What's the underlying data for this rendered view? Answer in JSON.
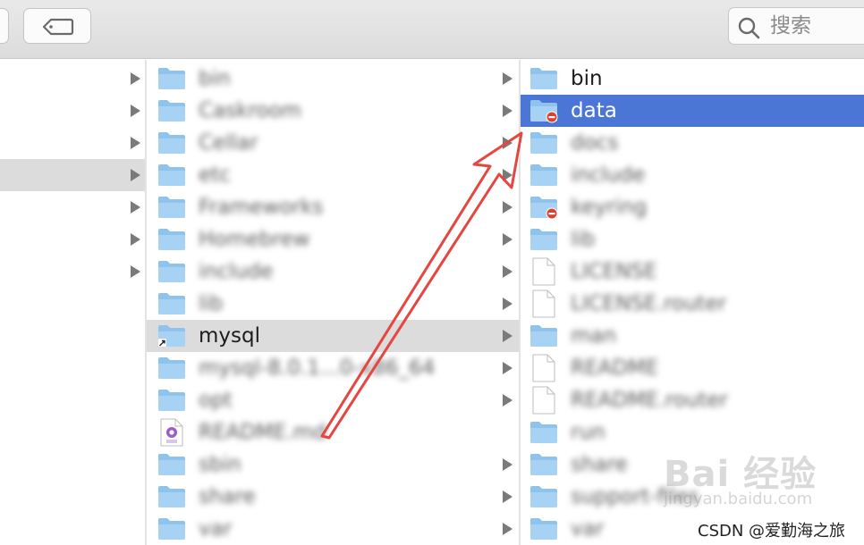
{
  "toolbar": {
    "search_placeholder": "搜索"
  },
  "column1": {
    "rows": [
      {
        "chevron": true,
        "selected": false
      },
      {
        "chevron": true,
        "selected": false
      },
      {
        "chevron": true,
        "selected": false
      },
      {
        "chevron": true,
        "selected": true
      },
      {
        "chevron": true,
        "selected": false
      },
      {
        "chevron": true,
        "selected": false
      },
      {
        "chevron": true,
        "selected": false
      }
    ]
  },
  "column2": {
    "items": [
      {
        "label": "bin",
        "type": "folder",
        "blurred": true,
        "chevron": true
      },
      {
        "label": "Caskroom",
        "type": "folder",
        "blurred": true,
        "chevron": true
      },
      {
        "label": "Cellar",
        "type": "folder",
        "blurred": true,
        "chevron": true
      },
      {
        "label": "etc",
        "type": "folder",
        "blurred": true,
        "chevron": true
      },
      {
        "label": "Frameworks",
        "type": "folder",
        "blurred": true,
        "chevron": true
      },
      {
        "label": "Homebrew",
        "type": "folder",
        "blurred": true,
        "chevron": true
      },
      {
        "label": "include",
        "type": "folder",
        "blurred": true,
        "chevron": true
      },
      {
        "label": "lib",
        "type": "folder",
        "blurred": true,
        "chevron": true
      },
      {
        "label": "mysql",
        "type": "alias-folder",
        "blurred": false,
        "chevron": true,
        "selected": true
      },
      {
        "label": "mysql-8.0.1...0-x86_64",
        "type": "folder",
        "blurred": true,
        "chevron": true
      },
      {
        "label": "opt",
        "type": "folder",
        "blurred": true,
        "chevron": true
      },
      {
        "label": "README.md",
        "type": "md-file",
        "blurred": true,
        "chevron": false
      },
      {
        "label": "sbin",
        "type": "folder",
        "blurred": true,
        "chevron": true
      },
      {
        "label": "share",
        "type": "folder",
        "blurred": true,
        "chevron": true
      },
      {
        "label": "var",
        "type": "folder",
        "blurred": true,
        "chevron": true
      }
    ]
  },
  "column3": {
    "items": [
      {
        "label": "bin",
        "type": "folder",
        "blurred": false
      },
      {
        "label": "data",
        "type": "restricted-folder",
        "blurred": false,
        "selected": true
      },
      {
        "label": "docs",
        "type": "folder",
        "blurred": true
      },
      {
        "label": "include",
        "type": "folder",
        "blurred": true
      },
      {
        "label": "keyring",
        "type": "restricted-folder",
        "blurred": true
      },
      {
        "label": "lib",
        "type": "folder",
        "blurred": true
      },
      {
        "label": "LICENSE",
        "type": "file",
        "blurred": true
      },
      {
        "label": "LICENSE.router",
        "type": "file",
        "blurred": true
      },
      {
        "label": "man",
        "type": "folder",
        "blurred": true
      },
      {
        "label": "README",
        "type": "file",
        "blurred": true
      },
      {
        "label": "README.router",
        "type": "file",
        "blurred": true
      },
      {
        "label": "run",
        "type": "folder",
        "blurred": true
      },
      {
        "label": "share",
        "type": "folder",
        "blurred": true
      },
      {
        "label": "support-files",
        "type": "folder",
        "blurred": true
      },
      {
        "label": "var",
        "type": "folder",
        "blurred": true
      }
    ]
  },
  "annotation": {
    "color": "#e5463f"
  },
  "colors": {
    "selection_blue": "#4b76d6",
    "selection_gray": "#dcdcdc",
    "folder_blue": "#8ec3ee"
  },
  "watermarks": {
    "baidu": "Bai 经验",
    "jingyan": "jingyan.baidu.com",
    "csdn": "CSDN @爱勤海之旅"
  }
}
